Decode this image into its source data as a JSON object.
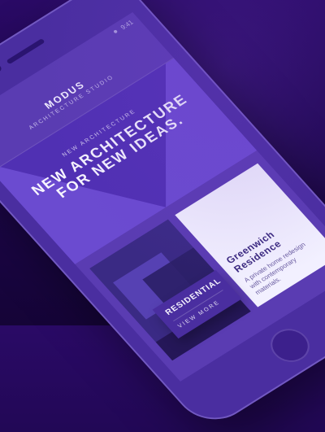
{
  "status_bar": {
    "carrier": "•••••",
    "time": "9:41"
  },
  "app": {
    "brand_logo_text": "MODUS",
    "brand_subtitle": "ARCHITECTURE STUDIO"
  },
  "hero": {
    "kicker": "NEW ARCHITECTURE",
    "title_line_1": "NEW ARCHITECTURE",
    "title_line_2": "FOR NEW IDEAS."
  },
  "project": {
    "category_label": "RESIDENTIAL",
    "cta_label": "VIEW MORE",
    "name": "Greenwich Residence",
    "description": "A private home redesign with contemporary materials."
  },
  "icons": {
    "menu": "menu-icon",
    "speaker": "speaker-icon",
    "camera": "camera-icon",
    "home_button": "home-button-icon"
  },
  "colors": {
    "background_top": "#2a0a66",
    "background_bottom": "#150437",
    "accent": "#6b4bd0"
  }
}
